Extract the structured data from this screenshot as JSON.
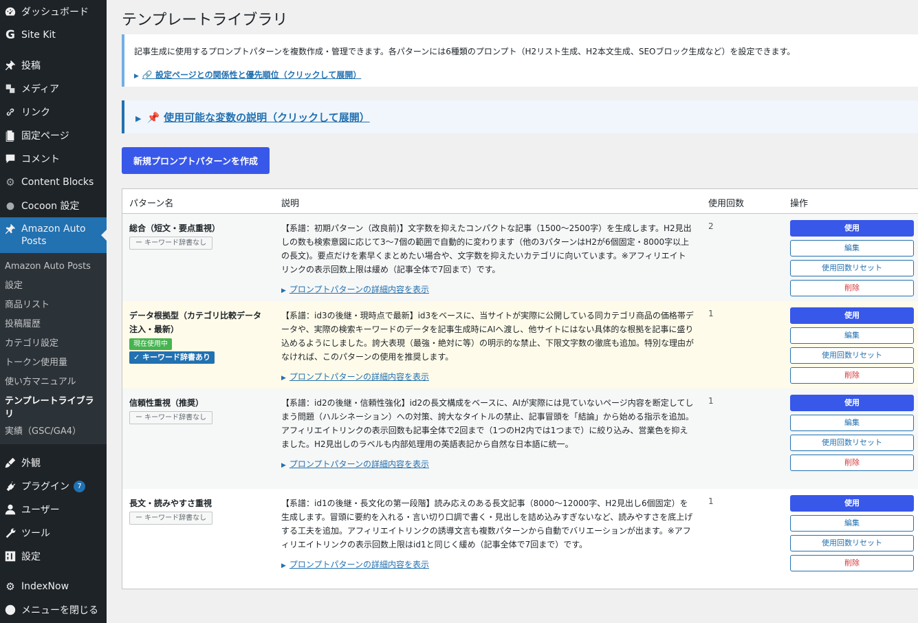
{
  "sidebar": {
    "items_top": [
      {
        "label": "ダッシュボード",
        "icon": "dashboard-icon"
      },
      {
        "label": "Site Kit",
        "icon": "sitekit-icon"
      }
    ],
    "items_main": [
      {
        "label": "投稿",
        "icon": "pin-icon"
      },
      {
        "label": "メディア",
        "icon": "media-icon"
      },
      {
        "label": "リンク",
        "icon": "link-icon"
      },
      {
        "label": "固定ページ",
        "icon": "page-icon"
      },
      {
        "label": "コメント",
        "icon": "comment-icon"
      },
      {
        "label": "Content Blocks",
        "icon": "gear-icon"
      },
      {
        "label": "Cocoon 設定",
        "icon": "circle-icon"
      }
    ],
    "current": {
      "label": "Amazon Auto Posts",
      "icon": "pin-icon"
    },
    "submenu": [
      "Amazon Auto Posts",
      "設定",
      "商品リスト",
      "投稿履歴",
      "カテゴリ設定",
      "トークン使用量",
      "使い方マニュアル",
      "テンプレートライブラリ",
      "実績（GSC/GA4）"
    ],
    "items_bottom": [
      {
        "label": "外観",
        "icon": "brush-icon"
      },
      {
        "label": "プラグイン",
        "icon": "plugin-icon",
        "badge": "7"
      },
      {
        "label": "ユーザー",
        "icon": "user-icon"
      },
      {
        "label": "ツール",
        "icon": "wrench-icon"
      },
      {
        "label": "設定",
        "icon": "settings-icon"
      }
    ],
    "items_extra": [
      {
        "label": "IndexNow",
        "icon": "gear-icon"
      },
      {
        "label": "メニューを閉じる",
        "icon": "collapse-icon"
      }
    ]
  },
  "page": {
    "title": "テンプレートライブラリ",
    "notice_text": "記事生成に使用するプロンプトパターンを複数作成・管理できます。各パターンには6種類のプロンプト（H2リスト生成、H2本文生成、SEOブロック生成など）を設定できます。",
    "notice_link": "🔗 設定ページとの関係性と優先順位（クリックして展開）",
    "vars_link": "使用可能な変数の説明（クリックして展開）",
    "new_button": "新規プロンプトパターンを作成"
  },
  "table": {
    "headers": {
      "name": "パターン名",
      "desc": "説明",
      "count": "使用回数",
      "actions": "操作"
    },
    "detail_link": "プロンプトパターンの詳細内容を表示",
    "actions": {
      "use": "使用",
      "edit": "編集",
      "reset": "使用回数リセット",
      "delete": "削除"
    },
    "rows": [
      {
        "name": "総合（短文・要点重視）",
        "tag": "ー キーワード辞書なし",
        "desc": "【系譜：初期パターン（改良前)】文字数を抑えたコンパクトな記事（1500〜2500字）を生成します。H2見出しの数も検索意図に応じて3〜7個の範囲で自動的に変わります（他の3パターンはH2が6個固定・8000字以上の長文)。要点だけを素早くまとめたい場合や、文字数を抑えたいカテゴリに向いています。※アフィリエイトリンクの表示回数上限は緩め（記事全体で7回まで）です。",
        "count": "2"
      },
      {
        "name": "データ根拠型（カテゴリ比較データ注入・最新）",
        "status": "現在使用中",
        "tag": "✓ キーワード辞書あり",
        "desc": "【系譜：id3の後継・現時点で最新】id3をベースに、当サイトが実際に公開している同カテゴリ商品の価格帯データや、実際の検索キーワードのデータを記事生成時にAIへ渡し、他サイトにはない具体的な根拠を記事に盛り込めるようにしました。誇大表現（最強・絶対に等）の明示的な禁止、下限文字数の徹底も追加。特別な理由がなければ、このパターンの使用を推奨します。",
        "count": "1"
      },
      {
        "name": "信頼性重視（推奨）",
        "tag": "ー キーワード辞書なし",
        "desc": "【系譜：id2の後継・信頼性強化】id2の長文構成をベースに、AIが実際には見ていないページ内容を断定してしまう問題（ハルシネーション）への対策、誇大なタイトルの禁止、記事冒頭を「結論」から始める指示を追加。アフィリエイトリンクの表示回数も記事全体で2回まで（1つのH2内では1つまで）に絞り込み、営業色を抑えました。H2見出しのラベルも内部処理用の英語表記から自然な日本語に統一。",
        "count": "1"
      },
      {
        "name": "長文・読みやすさ重視",
        "tag": "ー キーワード辞書なし",
        "desc": "【系譜：id1の後継・長文化の第一段階】読み応えのある長文記事（8000〜12000字、H2見出し6個固定）を生成します。冒頭に要約を入れる・言い切り口調で書く・見出しを詰め込みすぎないなど、読みやすさを底上げする工夫を追加。アフィリエイトリンクの誘導文言も複数パターンから自動でバリエーションが出ます。※アフィリエイトリンクの表示回数上限はid1と同じく緩め（記事全体で7回まで）です。",
        "count": "1"
      }
    ]
  }
}
